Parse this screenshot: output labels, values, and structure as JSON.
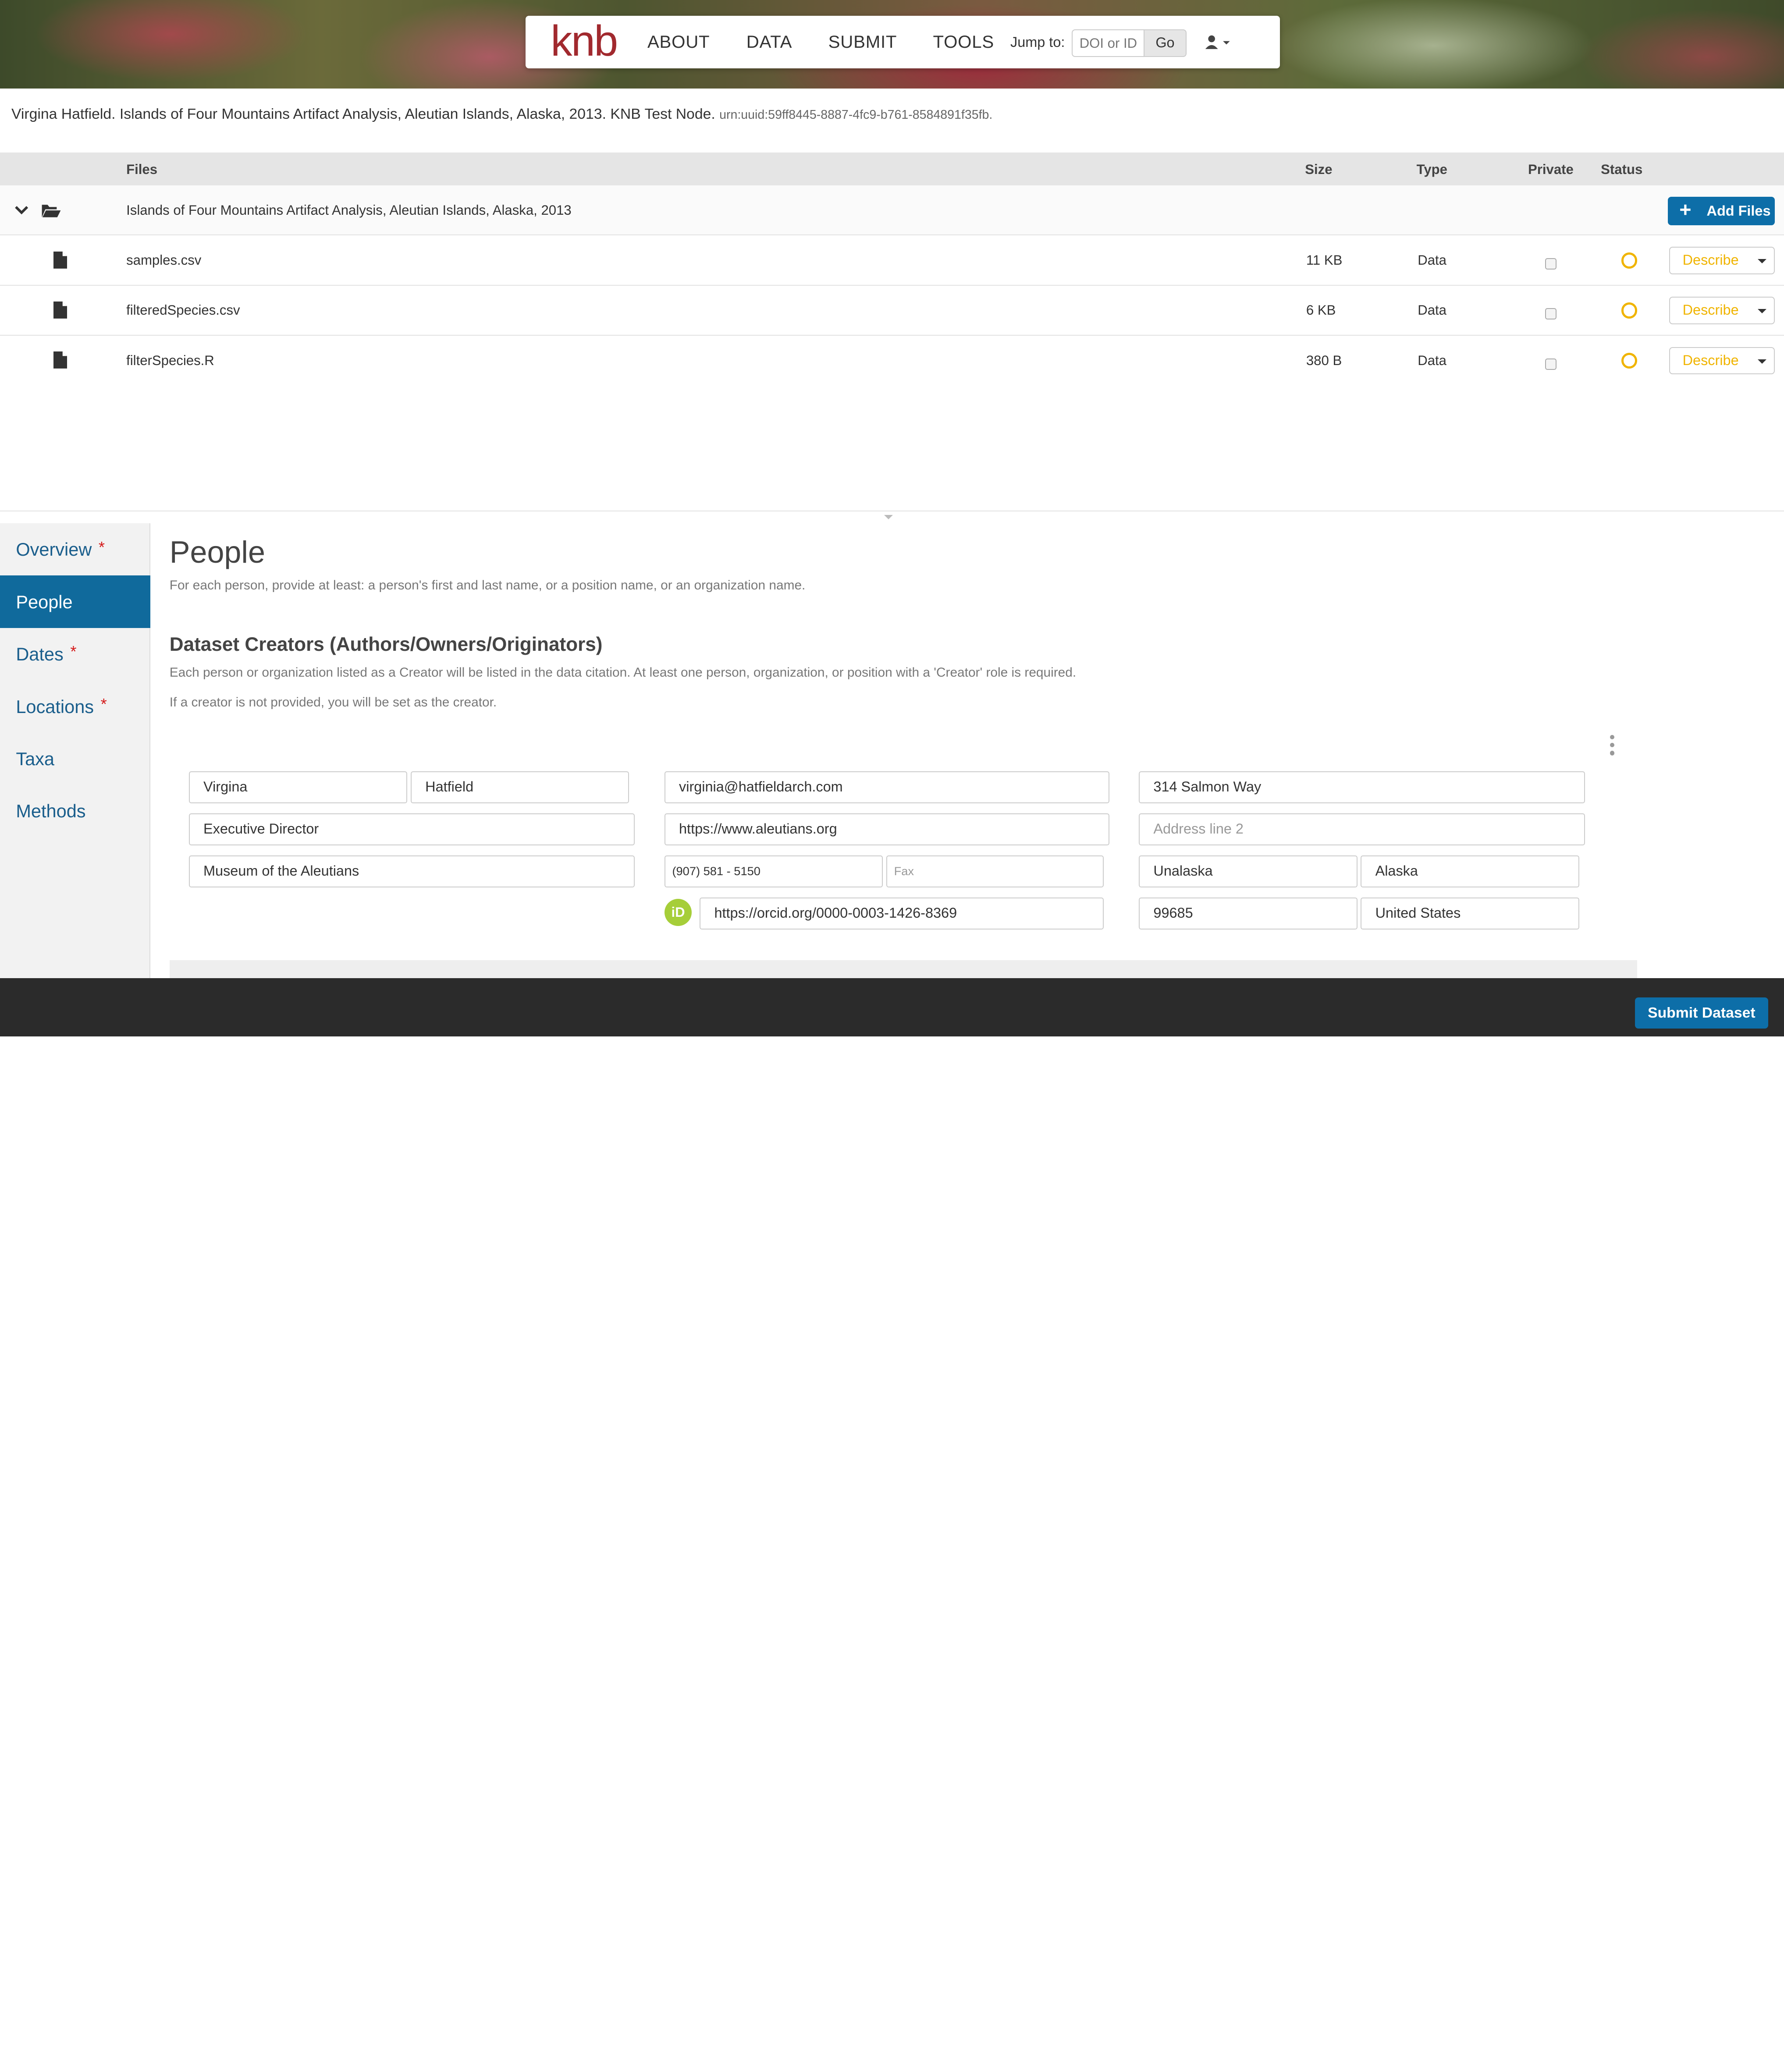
{
  "nav": {
    "logo": "knb",
    "links": [
      "ABOUT",
      "DATA",
      "SUBMIT",
      "TOOLS"
    ],
    "jump_label": "Jump to:",
    "jump_placeholder": "DOI or ID",
    "go_label": "Go",
    "user_icon": "user-icon"
  },
  "citation": {
    "text": "Virgina Hatfield. Islands of Four Mountains Artifact Analysis, Aleutian Islands, Alaska, 2013. KNB Test Node.",
    "identifier": "urn:uuid:59ff8445-8887-4fc9-b761-8584891f35fb."
  },
  "files_table": {
    "headers": {
      "files": "Files",
      "size": "Size",
      "type": "Type",
      "private": "Private",
      "status": "Status"
    },
    "folder_name": "Islands of Four Mountains Artifact Analysis, Aleutian Islands, Alaska, 2013",
    "add_files_label": "Add Files",
    "rows": [
      {
        "name": "samples.csv",
        "size": "11 KB",
        "type": "Data",
        "describe": "Describe"
      },
      {
        "name": "filteredSpecies.csv",
        "size": "6 KB",
        "type": "Data",
        "describe": "Describe"
      },
      {
        "name": "filterSpecies.R",
        "size": "380 B",
        "type": "Data",
        "describe": "Describe"
      }
    ],
    "status_color": "#f0b400"
  },
  "sidebar": {
    "items": [
      {
        "label": "Overview",
        "required": "*"
      },
      {
        "label": "People",
        "required": ""
      },
      {
        "label": "Dates",
        "required": "*"
      },
      {
        "label": "Locations",
        "required": "*"
      },
      {
        "label": "Taxa",
        "required": ""
      },
      {
        "label": "Methods",
        "required": ""
      }
    ],
    "active": "People"
  },
  "people_section": {
    "title": "People",
    "help": "For each person, provide at least: a person's first and last name, or a position name, or an organization name.",
    "creators_title": "Dataset Creators (Authors/Owners/Originators)",
    "creators_help_1": "Each person or organization listed as a Creator will be listed in the data citation. At least one person, organization, or position with a 'Creator' role is required.",
    "creators_help_2": "If a creator is not provided, you will be set as the creator.",
    "person": {
      "first_name": "Virgina",
      "last_name": "Hatfield",
      "position": "Executive Director",
      "organization": "Museum of the Aleutians",
      "email": "virginia@hatfieldarch.com",
      "website": "https://www.aleutians.org",
      "phone": "(907) 581 - 5150",
      "fax_placeholder": "Fax",
      "orcid_badge": "iD",
      "orcid": "https://orcid.org/0000-0003-1426-8369",
      "address_1": "314 Salmon Way",
      "address_2_placeholder": "Address line 2",
      "city": "Unalaska",
      "state": "Alaska",
      "zip": "99685",
      "country": "United States"
    }
  },
  "footer": {
    "submit_label": "Submit Dataset"
  },
  "colors": {
    "brand": "#a1292e",
    "primary": "#0d6ea8",
    "sidebar_active": "#106a9c",
    "required": "#d41a1a",
    "orcid": "#a6ce39"
  }
}
